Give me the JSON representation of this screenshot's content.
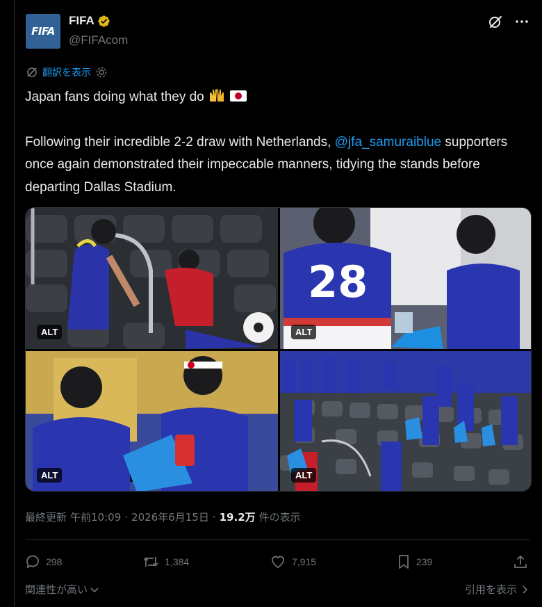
{
  "author": {
    "avatar_text": "FIFA",
    "name": "FIFA",
    "handle": "@FIFAcom"
  },
  "translate": {
    "label": "翻訳を表示"
  },
  "post": {
    "line1": "Japan fans doing what they do",
    "para2_before": "Following their incredible 2-2 draw with Netherlands,",
    "mention": "@jfa_samuraiblue",
    "para2_after": "supporters once again demonstrated their impeccable manners, tidying the stands before departing Dallas Stadium."
  },
  "media": {
    "alt_label": "ALT",
    "photos": [
      {
        "name": "photo-fans-cleaning-seats"
      },
      {
        "name": "photo-fan-number-28"
      },
      {
        "name": "photo-fans-with-bags"
      },
      {
        "name": "photo-crowd-tidying-stands"
      }
    ]
  },
  "meta": {
    "updated_label": "最終更新",
    "time": "午前10:09",
    "sep1": "·",
    "date": "2026年6月15日",
    "sep2": "·",
    "views_count": "19.2万",
    "views_label": "件の表示"
  },
  "actions": {
    "replies": "298",
    "reposts": "1,384",
    "likes": "7,915",
    "bookmarks": "239"
  },
  "footer": {
    "related_label": "関連性が高い",
    "quotes_label": "引用を表示"
  },
  "colors": {
    "background": "#000000",
    "text": "#e7e9ea",
    "muted": "#71767b",
    "link": "#1d9bf0",
    "verified_gold": "#e2b719",
    "fifa_blue": "#326295"
  }
}
